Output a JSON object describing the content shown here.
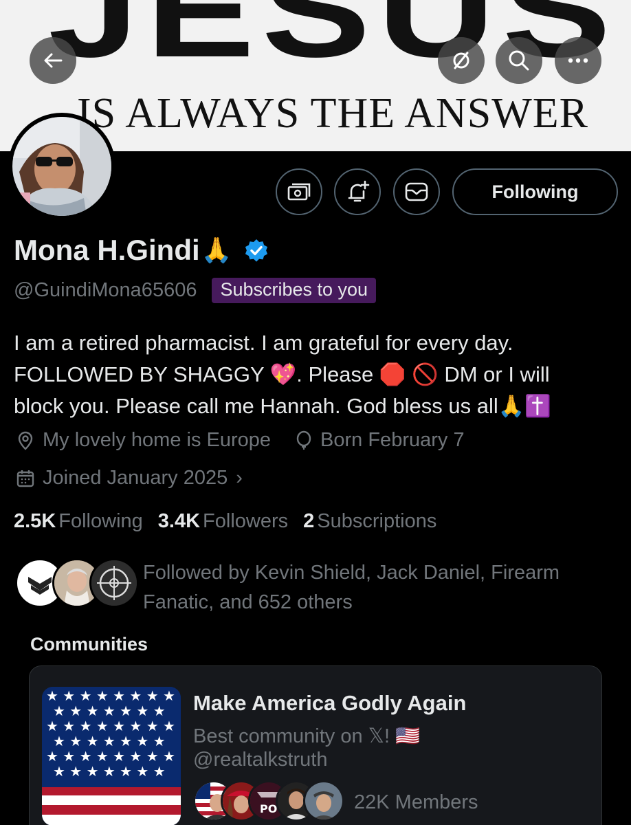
{
  "banner": {
    "big_text": "JESUS",
    "sub_text": "IS ALWAYS THE ANSWER"
  },
  "nav": {
    "back_icon": "back-arrow-icon",
    "hide_icon": "eye-slash-icon",
    "search_icon": "search-icon",
    "more_icon": "more-icon"
  },
  "actions": {
    "following_label": "Following"
  },
  "profile": {
    "name": "Mona H.Gindi",
    "name_emoji": "🙏",
    "handle": "@GuindiMona65606",
    "subscribes_badge": "Subscribes to you",
    "bio_lines": [
      "I am a retired pharmacist. I am grateful for every day.",
      "FOLLOWED BY SHAGGY 💖. Please 🛑 🚫  DM or I will",
      "block you. Please call me Hannah. God bless us all🙏✝️"
    ],
    "location": "My lovely home is Europe",
    "birthday": "Born February 7",
    "joined": "Joined January 2025",
    "joined_chevron": "›"
  },
  "stats": {
    "following_count": "2.5K",
    "following_label": "Following",
    "followers_count": "3.4K",
    "followers_label": "Followers",
    "subscriptions_count": "2",
    "subscriptions_label": "Subscriptions"
  },
  "followed_by": {
    "text_line1": "Followed by Kevin Shield, Jack Daniel, Firearm",
    "text_line2": "Fanatic, and 652 others"
  },
  "communities": {
    "title": "Communities",
    "card": {
      "name": "Make America Godly Again",
      "description": "Best community on 𝕏! 🇺🇸",
      "handle": "@realtalkstruth",
      "members": "22K Members"
    }
  },
  "colors": {
    "background": "#000000",
    "text_primary": "#e7e9ea",
    "text_secondary": "#71767b",
    "verified": "#1d9bf0",
    "subscribes_badge_bg": "#461a5c",
    "border": "#536471"
  }
}
